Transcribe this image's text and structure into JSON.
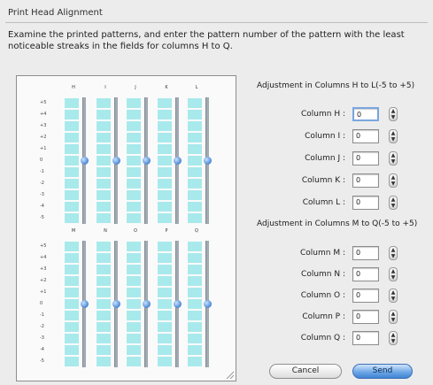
{
  "dialog": {
    "title": "Print Head Alignment",
    "instructions": "Examine the printed patterns, and enter the pattern number of the pattern with the least noticeable streaks in the fields for columns H to Q."
  },
  "preview": {
    "levels": [
      "+5",
      "+4",
      "+3",
      "+2",
      "+1",
      "0",
      "-1",
      "-2",
      "-3",
      "-4",
      "-5"
    ],
    "selected_level": "0",
    "group_top_columns": [
      "H",
      "I",
      "J",
      "K",
      "L"
    ],
    "group_bottom_columns": [
      "M",
      "N",
      "O",
      "P",
      "Q"
    ],
    "stripe_color": "#a8e9ec",
    "marker_color": "#4c87d4"
  },
  "section_h_l": {
    "heading": "Adjustment in Columns H to L(-5 to +5)",
    "rows": [
      {
        "label": "Column H :",
        "value": "0",
        "focused": true
      },
      {
        "label": "Column I :",
        "value": "0"
      },
      {
        "label": "Column J :",
        "value": "0"
      },
      {
        "label": "Column K :",
        "value": "0"
      },
      {
        "label": "Column L :",
        "value": "0"
      }
    ]
  },
  "section_m_q": {
    "heading": "Adjustment in Columns M to Q(-5 to +5)",
    "rows": [
      {
        "label": "Column M :",
        "value": "0"
      },
      {
        "label": "Column N :",
        "value": "0"
      },
      {
        "label": "Column O :",
        "value": "0"
      },
      {
        "label": "Column P :",
        "value": "0"
      },
      {
        "label": "Column Q :",
        "value": "0"
      }
    ]
  },
  "buttons": {
    "cancel": "Cancel",
    "send": "Send"
  }
}
